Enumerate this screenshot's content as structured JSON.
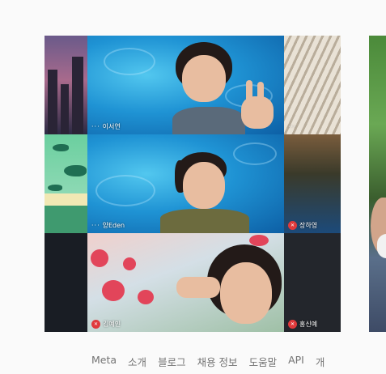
{
  "participants": [
    {
      "name": "이서연",
      "status": "more",
      "scene": "water"
    },
    {
      "name": "양Eden",
      "status": "more",
      "scene": "water"
    },
    {
      "name": "장하영",
      "status": "muted",
      "scene": "pergola"
    },
    {
      "name": "김예인",
      "status": "muted",
      "scene": "flowers"
    },
    {
      "name": "홍신예",
      "status": "muted",
      "scene": "dark"
    }
  ],
  "icons": {
    "more_options": "···",
    "mic_off": "mic-off-icon"
  },
  "footer_links": [
    "Meta",
    "소개",
    "블로그",
    "채용 정보",
    "도움말",
    "API",
    "개"
  ],
  "colors": {
    "page_background": "#fafafa",
    "footer_text": "#737373",
    "mute_badge": "#e0393b"
  }
}
